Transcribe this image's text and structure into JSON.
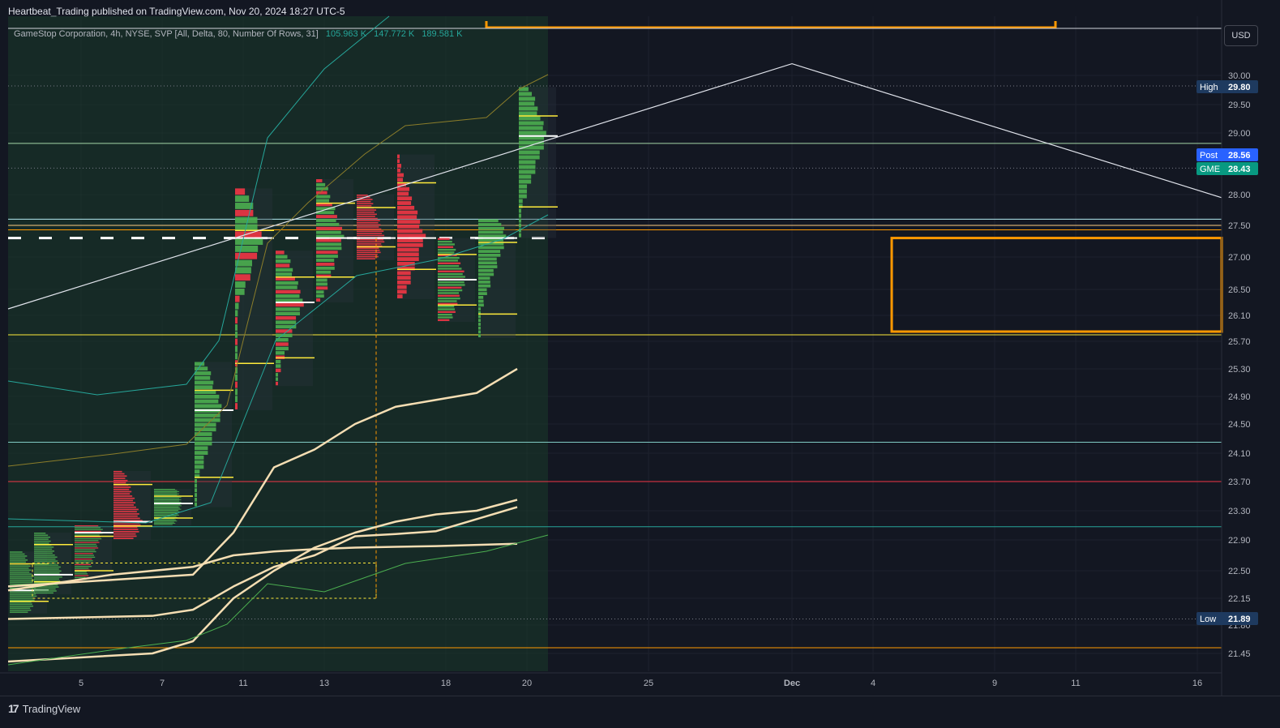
{
  "header": {
    "published": "Heartbeat_Trading published on TradingView.com, Nov 20, 2024 18:27 UTC-5"
  },
  "legend": {
    "title": "GameStop Corporation, 4h, NYSE, SVP [All, Delta, 80, Number Of Rows, 31]",
    "values": [
      "105.963 K",
      "147.772 K",
      "189.581 K"
    ]
  },
  "currency": "USD",
  "brand": {
    "name": "TradingView",
    "icon": "tradingview-logo-icon"
  },
  "colors": {
    "background": "#131722",
    "up": "#4caf50",
    "down": "#f23645",
    "yellow": "#ffeb3b",
    "orange": "#ff9800",
    "cream": "#f5deb3",
    "teal": "#26a69a",
    "label_blue": "#2962ff",
    "label_green": "#089981",
    "label_navy": "#1e3a5f"
  },
  "chart_data": {
    "type": "volume-profile-candlestick",
    "symbol": "GME",
    "timeframe": "4h",
    "exchange": "NYSE",
    "y_ticks": [
      "30.00",
      "29.50",
      "29.00",
      "28.00",
      "27.50",
      "27.00",
      "26.50",
      "26.10",
      "25.70",
      "25.30",
      "24.90",
      "24.50",
      "24.10",
      "23.70",
      "23.30",
      "22.90",
      "22.50",
      "22.15",
      "21.80",
      "21.45"
    ],
    "x_ticks": [
      "5",
      "7",
      "11",
      "13",
      "18",
      "20",
      "25",
      "Dec",
      "4",
      "9",
      "11",
      "16"
    ],
    "ylim": [
      21.3,
      30.5
    ],
    "price_labels": [
      {
        "label": "High",
        "value": "29.80"
      },
      {
        "label": "Post",
        "value": "28.56"
      },
      {
        "label": "GME",
        "value": "28.43"
      },
      {
        "label": "Low",
        "value": "21.89"
      }
    ],
    "profiles": [
      {
        "start": "Nov 1",
        "low": 21.95,
        "high": 22.75,
        "poc": 22.25,
        "delta": "up"
      },
      {
        "start": "Nov 4",
        "low": 22.2,
        "high": 23.0,
        "poc": 22.45,
        "delta": "up"
      },
      {
        "start": "Nov 5",
        "low": 22.35,
        "high": 23.1,
        "poc": 23.0,
        "delta": "mixed"
      },
      {
        "start": "Nov 6",
        "low": 22.9,
        "high": 23.85,
        "poc": 23.15,
        "delta": "down"
      },
      {
        "start": "Nov 7",
        "low": 23.1,
        "high": 23.6,
        "poc": 23.4,
        "delta": "up"
      },
      {
        "start": "Nov 8",
        "low": 23.35,
        "high": 25.4,
        "poc": 24.7,
        "delta": "up"
      },
      {
        "start": "Nov 11",
        "low": 24.7,
        "high": 28.1,
        "poc": 27.3,
        "delta": "mixed"
      },
      {
        "start": "Nov 12",
        "low": 25.05,
        "high": 27.1,
        "poc": 26.3,
        "delta": "mixed"
      },
      {
        "start": "Nov 13",
        "low": 26.3,
        "high": 28.25,
        "poc": 27.3,
        "delta": "mixed"
      },
      {
        "start": "Nov 14",
        "low": 26.95,
        "high": 28.0,
        "poc": 27.3,
        "delta": "down"
      },
      {
        "start": "Nov 15",
        "low": 26.35,
        "high": 28.65,
        "poc": 27.3,
        "delta": "down"
      },
      {
        "start": "Nov 18",
        "low": 26.0,
        "high": 27.3,
        "poc": 26.65,
        "delta": "mixed"
      },
      {
        "start": "Nov 19",
        "low": 25.75,
        "high": 27.6,
        "poc": 27.3,
        "delta": "up"
      },
      {
        "start": "Nov 20",
        "low": 27.3,
        "high": 29.8,
        "poc": 28.95,
        "delta": "up"
      }
    ],
    "horizontal_levels": [
      {
        "value": 29.82,
        "color": "#787b86",
        "style": "dotted"
      },
      {
        "value": 28.83,
        "color": "#a5d6a7",
        "style": "solid"
      },
      {
        "value": 28.43,
        "color": "#787b86",
        "style": "dotted"
      },
      {
        "value": 27.6,
        "color": "#b2ebf2",
        "style": "solid"
      },
      {
        "value": 27.5,
        "color": "#ffcc80",
        "style": "solid"
      },
      {
        "value": 27.43,
        "color": "#ff9800",
        "style": "solid"
      },
      {
        "value": 27.3,
        "color": "#ffffff",
        "style": "dashed"
      },
      {
        "value": 25.8,
        "color": "#ffeb3b",
        "style": "solid"
      },
      {
        "value": 24.25,
        "color": "#80cbc4",
        "style": "solid"
      },
      {
        "value": 23.7,
        "color": "#f23645",
        "style": "solid"
      },
      {
        "value": 23.08,
        "color": "#26a69a",
        "style": "solid"
      },
      {
        "value": 21.88,
        "color": "#787b86",
        "style": "dotted"
      },
      {
        "value": 21.52,
        "color": "#ff9800",
        "style": "solid"
      }
    ],
    "moving_averages": [
      {
        "color": "#f5deb3",
        "width": 2.5,
        "points": [
          [
            "Nov 1",
            21.35
          ],
          [
            "Nov 7",
            21.45
          ],
          [
            "Nov 8",
            21.6
          ],
          [
            "Nov 11",
            22.15
          ],
          [
            "Nov 12",
            22.5
          ],
          [
            "Nov 13",
            22.8
          ],
          [
            "Nov 14",
            23.0
          ],
          [
            "Nov 15",
            23.15
          ],
          [
            "Nov 18",
            23.25
          ],
          [
            "Nov 19",
            23.3
          ],
          [
            "Nov 20",
            23.45
          ]
        ]
      },
      {
        "color": "#f5deb3",
        "width": 2.5,
        "points": [
          [
            "Nov 1",
            22.25
          ],
          [
            "Nov 6",
            22.45
          ],
          [
            "Nov 8",
            22.55
          ],
          [
            "Nov 11",
            22.7
          ],
          [
            "Nov 12",
            22.75
          ],
          [
            "Nov 13",
            22.78
          ],
          [
            "Nov 14",
            22.8
          ],
          [
            "Nov 15",
            22.81
          ],
          [
            "Nov 18",
            22.82
          ],
          [
            "Nov 20",
            22.85
          ]
        ]
      },
      {
        "color": "#f5deb3",
        "width": 2.5,
        "points": [
          [
            "Nov 1",
            21.88
          ],
          [
            "Nov 7",
            21.92
          ],
          [
            "Nov 8",
            22.0
          ],
          [
            "Nov 11",
            22.3
          ],
          [
            "Nov 12",
            22.55
          ],
          [
            "Nov 13",
            22.7
          ],
          [
            "Nov 14",
            22.95
          ],
          [
            "Nov 15",
            22.98
          ],
          [
            "Nov 18",
            23.02
          ],
          [
            "Nov 20",
            23.35
          ]
        ]
      },
      {
        "color": "#f5deb3",
        "width": 2.5,
        "points": [
          [
            "Nov 1",
            22.3
          ],
          [
            "Nov 8",
            22.45
          ],
          [
            "Nov 11",
            23.0
          ],
          [
            "Nov 12",
            23.9
          ],
          [
            "Nov 13",
            24.15
          ],
          [
            "Nov 14",
            24.5
          ],
          [
            "Nov 15",
            24.75
          ],
          [
            "Nov 18",
            24.85
          ],
          [
            "Nov 19",
            24.95
          ],
          [
            "Nov 20",
            25.3
          ]
        ]
      }
    ],
    "trendlines": [
      {
        "color": "#e0e3eb",
        "points": [
          [
            "Nov 1",
            26.2
          ],
          [
            "Nov 29",
            30.2
          ],
          [
            "Dec 16",
            27.95
          ]
        ]
      }
    ],
    "rectangles": [
      {
        "color": "#ff9800",
        "from": "Dec 4",
        "to": "Dec 16",
        "top": 27.3,
        "bottom": 25.85
      },
      {
        "color": "#ff9800",
        "from": "Nov 19",
        "to": "Dec 9",
        "top": 30.6,
        "bottom": 30.5
      }
    ]
  }
}
